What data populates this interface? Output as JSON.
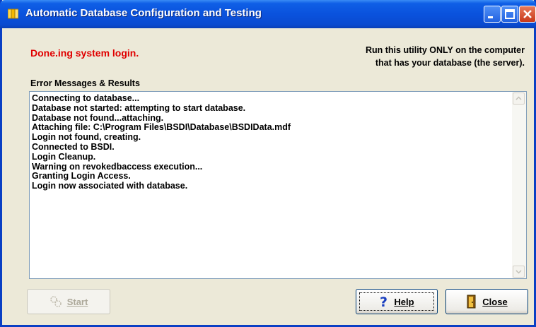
{
  "window": {
    "title": "Automatic Database Configuration and Testing",
    "icon": "database-config-icon"
  },
  "status": {
    "message": "Done.ing system login.",
    "color": "#e00000"
  },
  "warning": {
    "line1": "Run this utility ONLY on the computer",
    "line2": "that has your database (the server)."
  },
  "results": {
    "label": "Error Messages & Results",
    "lines": [
      "Connecting to database...",
      "Database not started: attempting to start database.",
      "Database not found...attaching.",
      "Attaching file: C:\\Program Files\\BSDI\\Database\\BSDIData.mdf",
      "Login not found, creating.",
      "Connected to BSDI.",
      "Login Cleanup.",
      "Warning on revokedbaccess execution...",
      "Granting Login Access.",
      "Login now associated with database."
    ]
  },
  "buttons": {
    "start_label": "Start",
    "help_label": "Help",
    "close_label": "Close"
  },
  "colors": {
    "titlebar": "#0a52dd",
    "window_bg": "#ece9d8",
    "status_red": "#e00000"
  }
}
